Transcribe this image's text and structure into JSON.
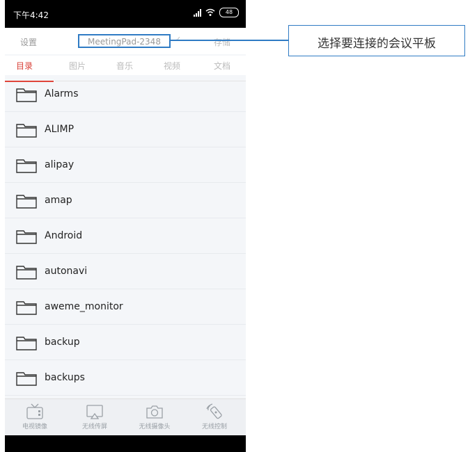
{
  "status_bar": {
    "time": "下午4:42",
    "battery": "48"
  },
  "top_bar": {
    "settings": "设置",
    "device": "MeetingPad-2348",
    "dropdown": "✓",
    "storage": "存储"
  },
  "tabs": [
    "目录",
    "图片",
    "音乐",
    "视频",
    "文档"
  ],
  "folders": [
    "Alarms",
    "ALIMP",
    "alipay",
    "amap",
    "Android",
    "autonavi",
    "aweme_monitor",
    "backup",
    "backups"
  ],
  "bottom_nav": [
    "电视镜像",
    "无线传屏",
    "无线摄像头",
    "无线控制"
  ],
  "annotation": {
    "text": "选择要连接的会议平板"
  },
  "colors": {
    "accent": "#d94139",
    "annotation": "#2f7bc4"
  }
}
